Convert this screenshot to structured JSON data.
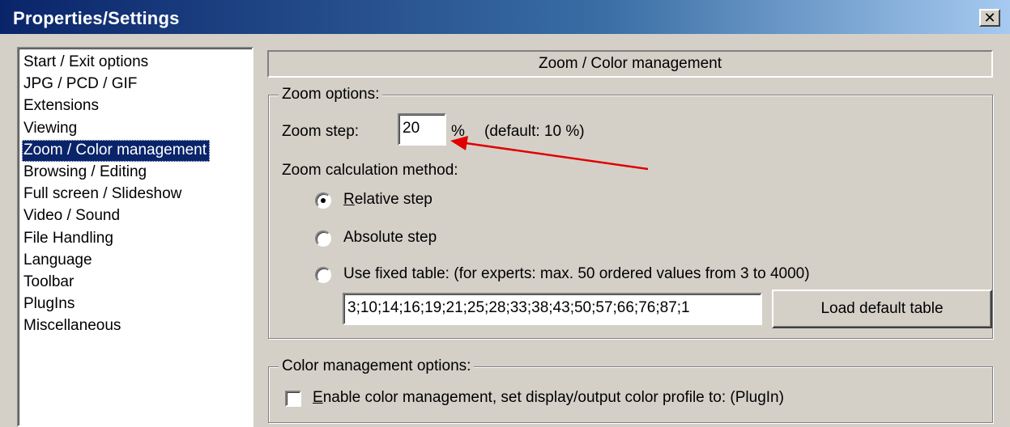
{
  "window": {
    "title": "Properties/Settings",
    "close_glyph": "✕"
  },
  "nav": {
    "items": [
      "Start / Exit options",
      "JPG / PCD / GIF",
      "Extensions",
      "Viewing",
      "Zoom / Color management",
      "Browsing / Editing",
      "Full screen / Slideshow",
      "Video / Sound",
      "File Handling",
      "Language",
      "Toolbar",
      "PlugIns",
      "Miscellaneous"
    ],
    "selected_index": 4
  },
  "section": {
    "title": "Zoom / Color management"
  },
  "zoom": {
    "group_label": "Zoom options:",
    "step_label": "Zoom step:",
    "step_value": "20",
    "step_unit": "%",
    "step_default": "(default: 10 %)",
    "method_label": "Zoom calculation method:",
    "options": [
      {
        "accel": "R",
        "rest": "elative step",
        "checked": true
      },
      {
        "accel": "",
        "rest": "Absolute step",
        "checked": false
      },
      {
        "accel": "",
        "rest": "Use fixed table: (for experts: max. 50 ordered values from 3 to 4000)",
        "checked": false
      }
    ],
    "table_value": "3;10;14;16;19;21;25;28;33;38;43;50;57;66;76;87;1",
    "load_default_label": "Load default table"
  },
  "color": {
    "group_label": "Color management options:",
    "enable_accel": "E",
    "enable_rest": "nable color management, set display/output color profile to: (PlugIn)",
    "enable_checked": false
  },
  "annotation": {
    "arrow_color": "#e00000"
  }
}
